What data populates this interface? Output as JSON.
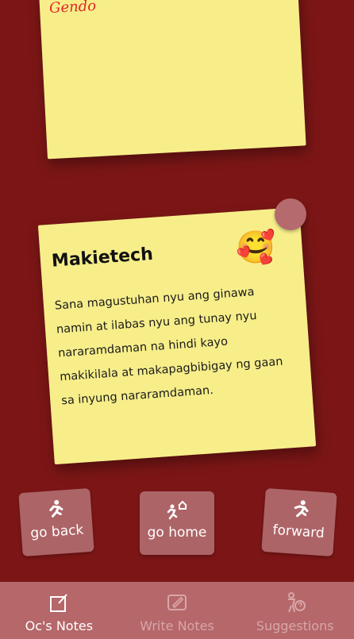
{
  "notes": {
    "top_note_title": "Gendo",
    "main_note": {
      "title": "Makietech",
      "body": "Sana magustuhan nyu ang ginawa namin at ilabas nyu ang tunay nyu nararamdaman na hindi kayo makikilala at makapagbibigay ng gaan sa inyung nararamdaman.",
      "emoji": "🥰"
    }
  },
  "nav_buttons": {
    "back_label": "go back",
    "home_label": "go home",
    "forward_label": "forward"
  },
  "tabbar": {
    "tabs": [
      {
        "label": "Oc's Notes",
        "icon": "notes-icon",
        "active": true
      },
      {
        "label": "Write Notes",
        "icon": "pen-icon",
        "active": false
      },
      {
        "label": "Suggestions",
        "icon": "question-person-icon",
        "active": false
      }
    ]
  },
  "colors": {
    "background": "#7c1616",
    "note": "#f7ee8a",
    "button": "#ad6467",
    "tabbar": "#b5676a",
    "top_note_title": "#e0262a"
  }
}
